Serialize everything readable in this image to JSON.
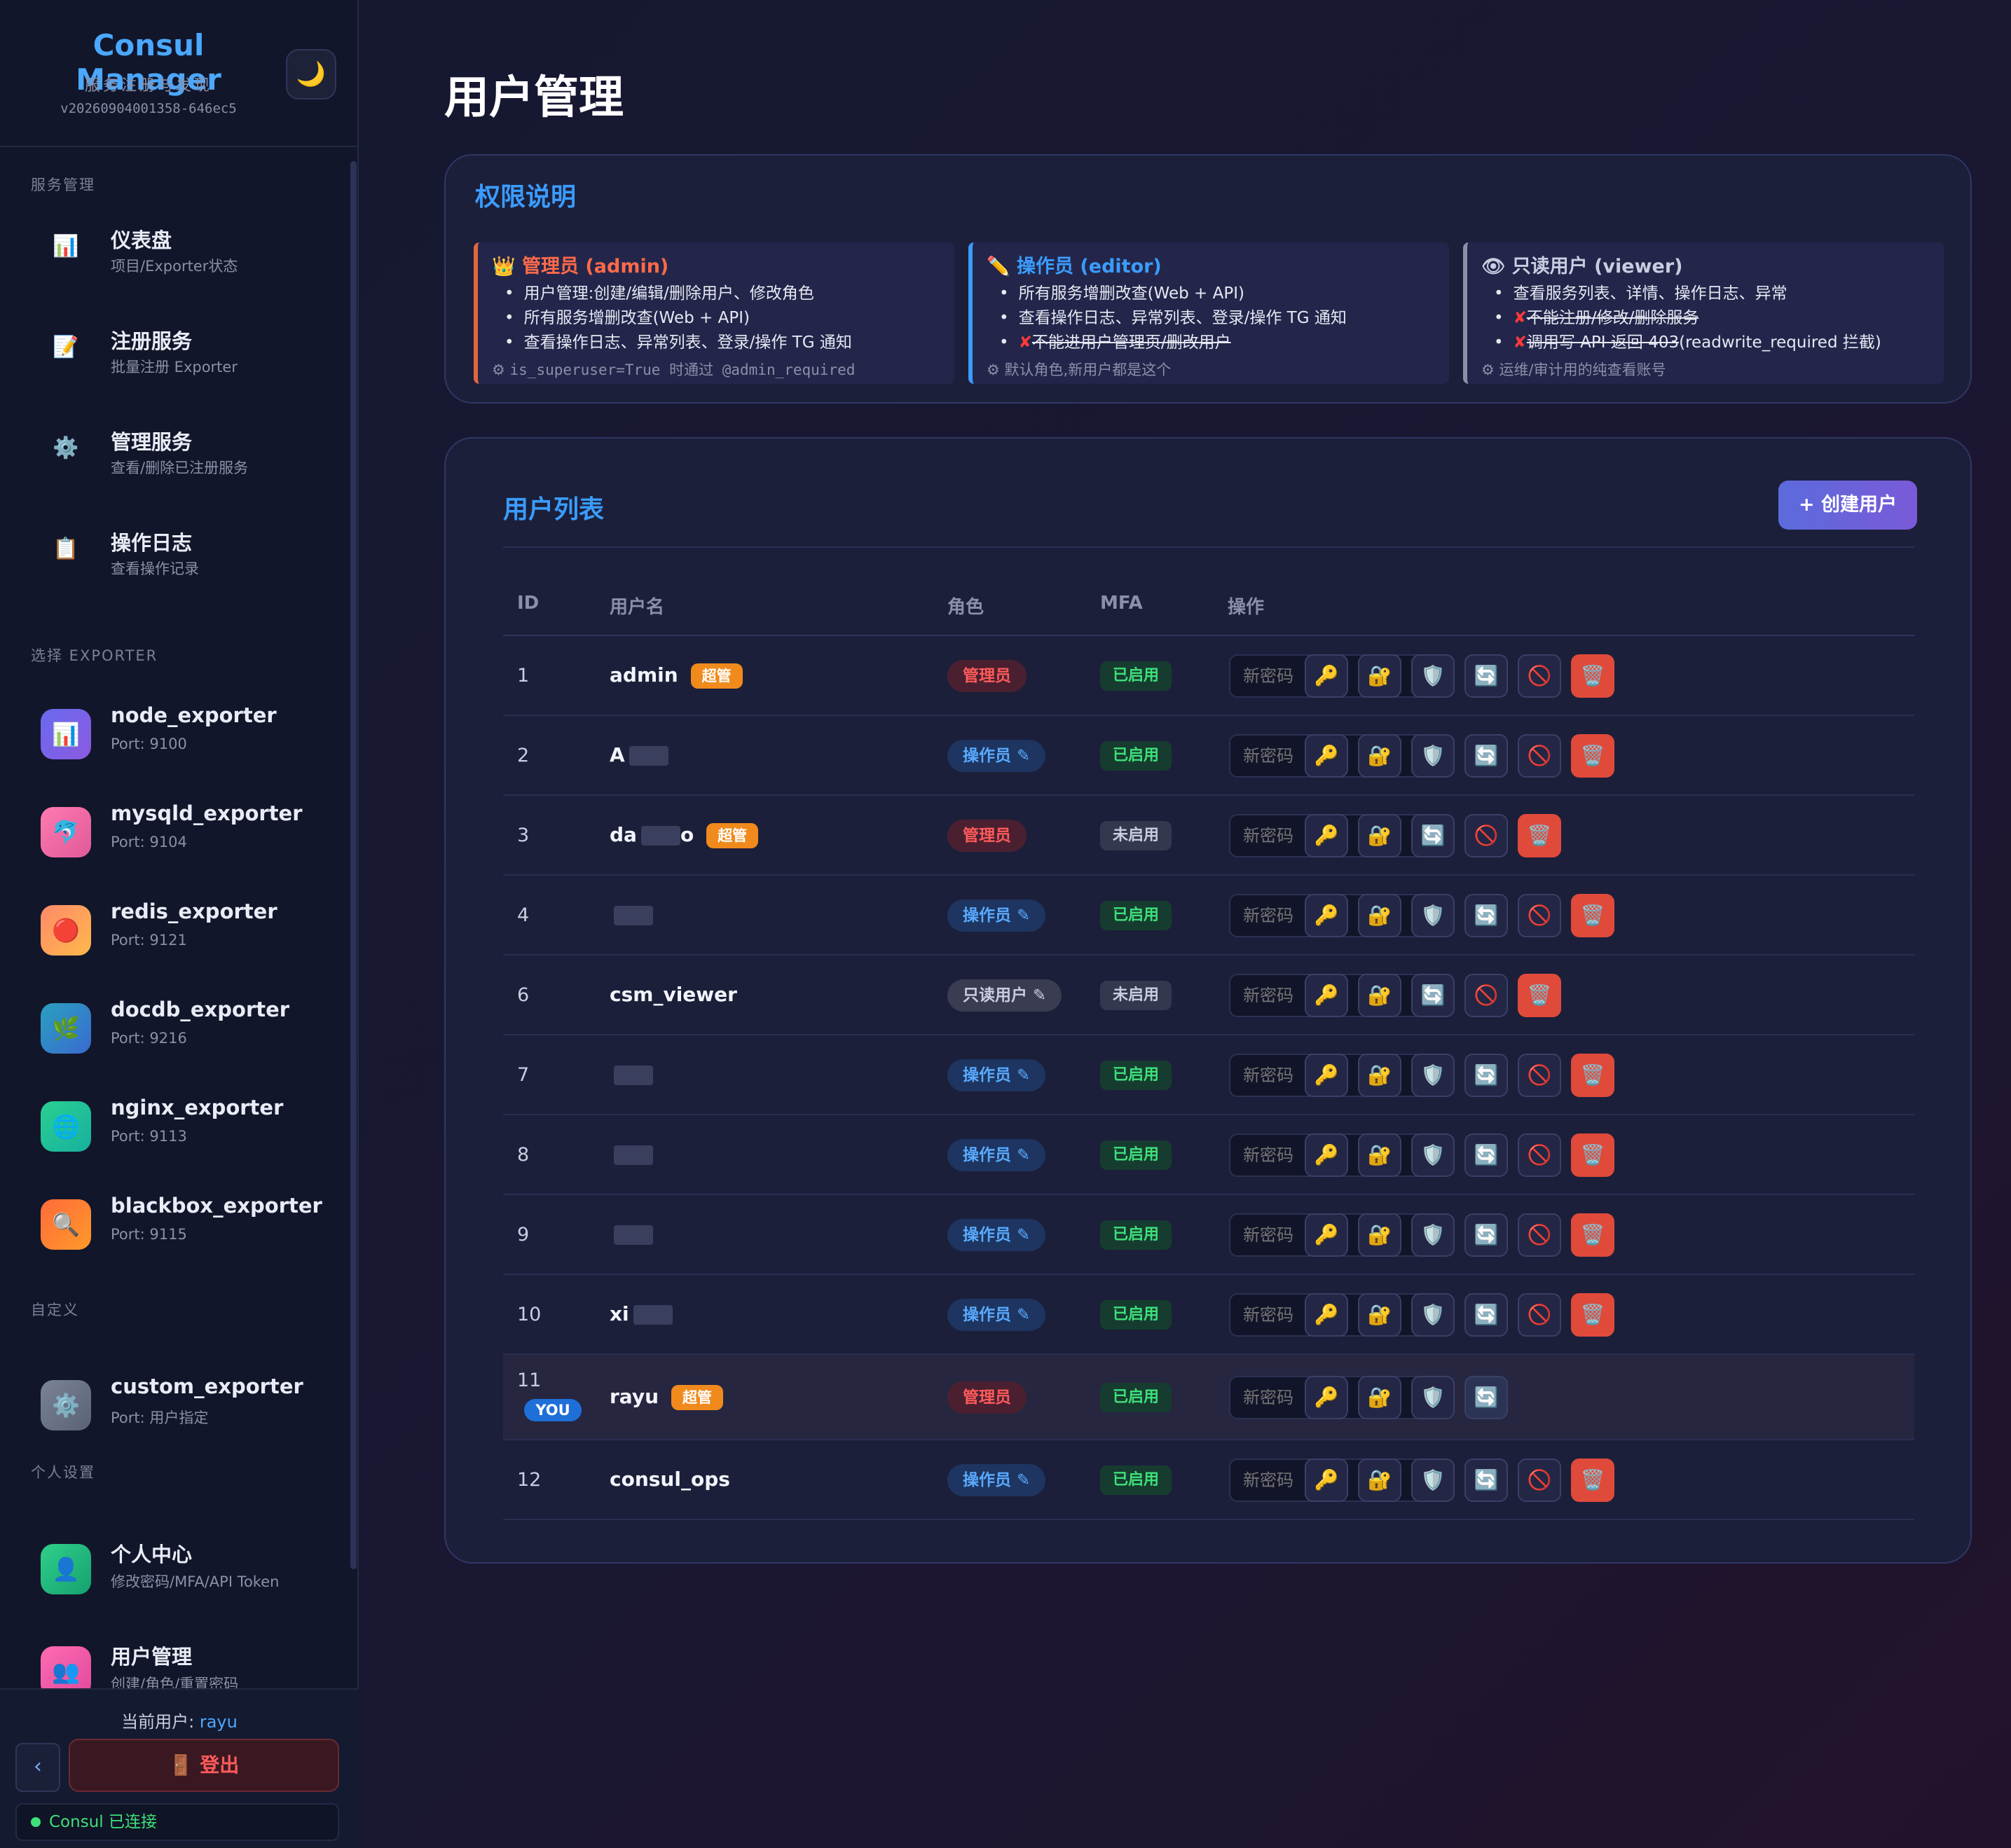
{
  "brand": {
    "title": "Consul Manager",
    "subtitle": "服务注册与发现",
    "version": "v20260904001358-646ec5",
    "theme_icon": "moon-icon"
  },
  "sidebar": {
    "sections": {
      "service": "服务管理",
      "exporter": "选择 EXPORTER",
      "custom": "自定义",
      "personal": "个人设置"
    },
    "service_items": [
      {
        "title": "仪表盘",
        "sub": "项目/Exporter状态",
        "icon": "bar-chart-icon"
      },
      {
        "title": "注册服务",
        "sub": "批量注册 Exporter",
        "icon": "memo-icon"
      },
      {
        "title": "管理服务",
        "sub": "查看/删除已注册服务",
        "icon": "gear-icon"
      },
      {
        "title": "操作日志",
        "sub": "查看操作记录",
        "icon": "clipboard-icon"
      }
    ],
    "exporters": [
      {
        "title": "node_exporter",
        "sub": "Port: 9100",
        "icon": "bar-chart-icon"
      },
      {
        "title": "mysqld_exporter",
        "sub": "Port: 9104",
        "icon": "dolphin-icon"
      },
      {
        "title": "redis_exporter",
        "sub": "Port: 9121",
        "icon": "red-circle-icon"
      },
      {
        "title": "docdb_exporter",
        "sub": "Port: 9216",
        "icon": "leaf-icon"
      },
      {
        "title": "nginx_exporter",
        "sub": "Port: 9113",
        "icon": "globe-icon"
      },
      {
        "title": "blackbox_exporter",
        "sub": "Port: 9115",
        "icon": "magnifier-icon"
      }
    ],
    "custom": {
      "title": "custom_exporter",
      "sub": "Port: 用户指定",
      "icon": "gear-icon"
    },
    "personal_items": [
      {
        "title": "个人中心",
        "sub": "修改密码/MFA/API Token",
        "icon": "user-icon"
      },
      {
        "title": "用户管理",
        "sub": "创建/角色/重置密码",
        "icon": "users-icon"
      }
    ],
    "current_user_label": "当前用户: ",
    "current_user": "rayu",
    "collapse_label": "‹",
    "logout_label": "登出",
    "logout_icon": "door-icon",
    "consul_status": "Consul 已连接",
    "status_color": "#3ee07a"
  },
  "main": {
    "title": "用户管理",
    "perm": {
      "title": "权限说明",
      "admin": {
        "head": "管理员 (admin)",
        "icon": "crown-icon",
        "items": [
          "用户管理:创建/编辑/删除用户、修改角色",
          "所有服务增删改查(Web + API)",
          "查看操作日志、异常列表、登录/操作 TG 通知"
        ],
        "note": "is_superuser=True 时通过 @admin_required",
        "color": "#ff6a4a"
      },
      "editor": {
        "head": "操作员 (editor)",
        "icon": "pencil-icon",
        "items": [
          "所有服务增删改查(Web + API)",
          "查看操作日志、异常列表、登录/操作 TG 通知"
        ],
        "denied": "不能进用户管理页/删改用户",
        "note": "默认角色,新用户都是这个",
        "color": "#3a9cff"
      },
      "viewer": {
        "head": "只读用户 (viewer)",
        "icon": "eye-icon",
        "items": [
          "查看服务列表、详情、操作日志、异常"
        ],
        "denied": [
          "不能注册/修改/删除服务",
          "调用写 API 返回 403"
        ],
        "denied_tail": "(readwrite_required 拦截)",
        "note": "运维/审计用的纯查看账号",
        "color": "#c9cde0"
      }
    },
    "users": {
      "title": "用户列表",
      "create_label": "+ 创建用户",
      "headers": {
        "id": "ID",
        "username": "用户名",
        "role": "角色",
        "mfa": "MFA",
        "actions": "操作"
      },
      "pwd_placeholder": "新密码",
      "super_label": "超管",
      "you_label": "YOU",
      "rows": [
        {
          "id": "1",
          "name": "admin",
          "super": true,
          "role": "管理员",
          "role_type": "admin",
          "mfa": "已启用",
          "mfa_on": true,
          "actions": [
            "key",
            "lock",
            "shield",
            "refresh",
            "ban",
            "delete"
          ]
        },
        {
          "id": "2",
          "name": "A",
          "redact": true,
          "role": "操作员 ✎",
          "role_type": "editor",
          "mfa": "已启用",
          "mfa_on": true,
          "actions": [
            "key",
            "lock",
            "shield",
            "refresh",
            "ban",
            "delete"
          ]
        },
        {
          "id": "3",
          "name": "da",
          "redact": true,
          "name_tail": "o",
          "super": true,
          "role": "管理员",
          "role_type": "admin",
          "mfa": "未启用",
          "mfa_on": false,
          "actions": [
            "key",
            "lock",
            "refresh",
            "ban",
            "delete"
          ]
        },
        {
          "id": "4",
          "name": "",
          "redact": true,
          "role": "操作员 ✎",
          "role_type": "editor",
          "mfa": "已启用",
          "mfa_on": true,
          "actions": [
            "key",
            "lock",
            "shield",
            "refresh",
            "ban",
            "delete"
          ]
        },
        {
          "id": "6",
          "name": "csm_viewer",
          "role": "只读用户 ✎",
          "role_type": "viewer",
          "mfa": "未启用",
          "mfa_on": false,
          "actions": [
            "key",
            "lock",
            "refresh",
            "ban",
            "delete"
          ]
        },
        {
          "id": "7",
          "name": "",
          "redact": true,
          "role": "操作员 ✎",
          "role_type": "editor",
          "mfa": "已启用",
          "mfa_on": true,
          "actions": [
            "key",
            "lock",
            "shield",
            "refresh",
            "ban",
            "delete"
          ]
        },
        {
          "id": "8",
          "name": "",
          "redact": true,
          "role": "操作员 ✎",
          "role_type": "editor",
          "mfa": "已启用",
          "mfa_on": true,
          "actions": [
            "key",
            "lock",
            "shield",
            "refresh",
            "ban",
            "delete"
          ]
        },
        {
          "id": "9",
          "name": "",
          "redact": true,
          "role": "操作员 ✎",
          "role_type": "editor",
          "mfa": "已启用",
          "mfa_on": true,
          "actions": [
            "key",
            "lock",
            "shield",
            "refresh",
            "ban",
            "delete"
          ]
        },
        {
          "id": "10",
          "name": "xi",
          "redact": true,
          "role": "操作员 ✎",
          "role_type": "editor",
          "mfa": "已启用",
          "mfa_on": true,
          "actions": [
            "key",
            "lock",
            "shield",
            "refresh",
            "ban",
            "delete"
          ]
        },
        {
          "id": "11",
          "name": "rayu",
          "super": true,
          "you": true,
          "role": "管理员",
          "role_type": "admin",
          "mfa": "已启用",
          "mfa_on": true,
          "actions": [
            "key",
            "lock",
            "shield",
            "refresh"
          ]
        },
        {
          "id": "12",
          "name": "consul_ops",
          "role": "操作员 ✎",
          "role_type": "editor",
          "mfa": "已启用",
          "mfa_on": true,
          "actions": [
            "key",
            "lock",
            "shield",
            "refresh",
            "ban",
            "delete"
          ]
        }
      ]
    }
  }
}
